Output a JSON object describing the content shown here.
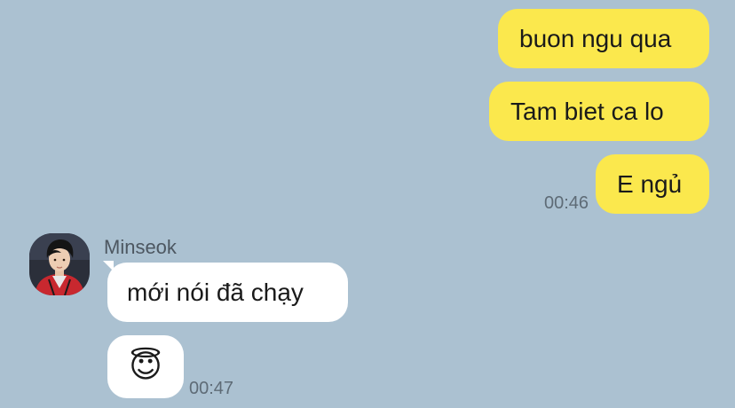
{
  "colors": {
    "background": "#abc1d1",
    "outgoing_bubble": "#fbe84d",
    "incoming_bubble": "#ffffff"
  },
  "outgoing": [
    {
      "text": "buon ngu qua"
    },
    {
      "text": "Tam biet ca lo"
    },
    {
      "text": "E ngủ",
      "time": "00:46"
    }
  ],
  "incoming": {
    "sender": "Minseok",
    "avatar_icon": "profile-photo",
    "messages": [
      {
        "text": "mới nói đã chạy"
      },
      {
        "text": "😇",
        "time": "00:47"
      }
    ]
  }
}
